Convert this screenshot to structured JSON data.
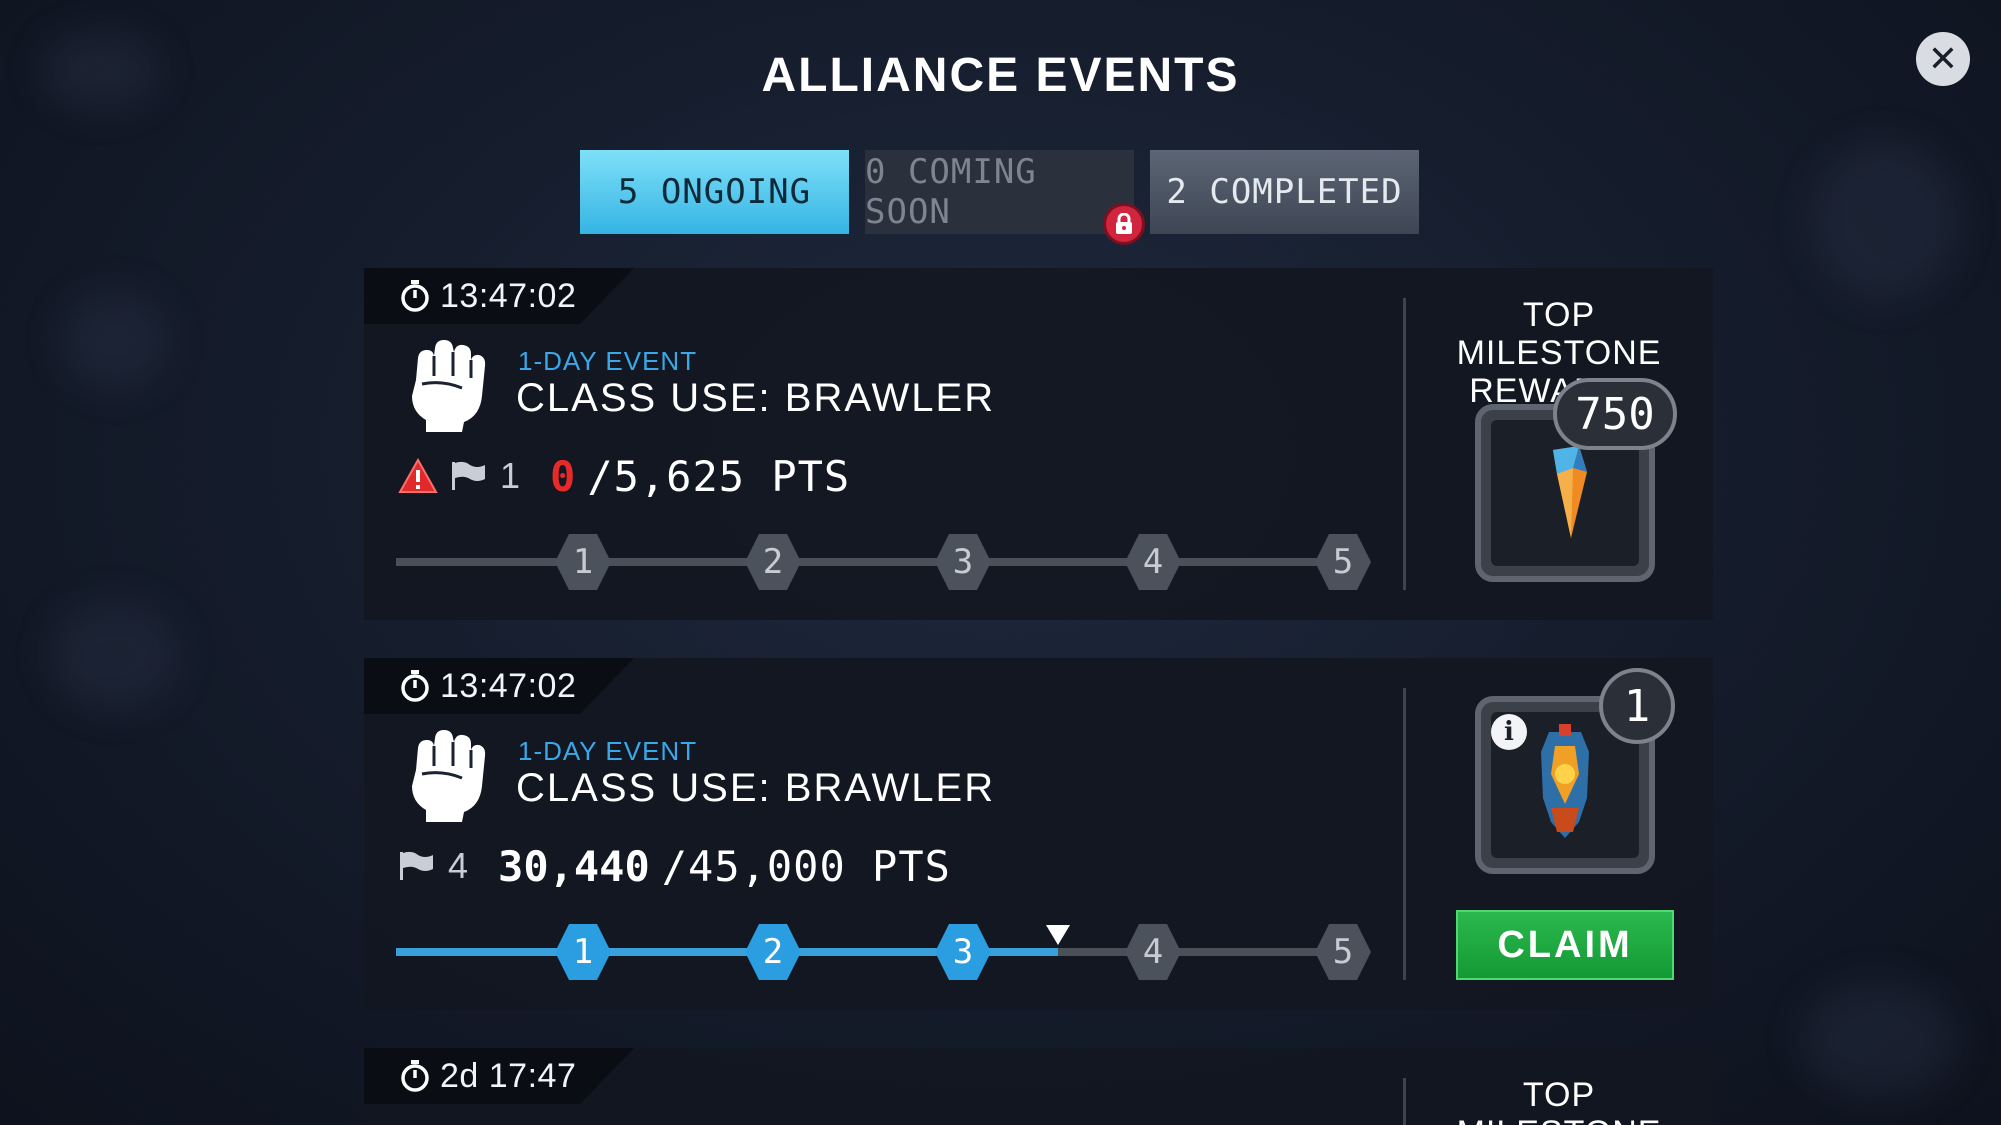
{
  "header": {
    "title": "ALLIANCE EVENTS"
  },
  "tabs": [
    {
      "label": "5 ONGOING",
      "active": true
    },
    {
      "label": "0 COMING SOON",
      "locked": true
    },
    {
      "label": "2 COMPLETED"
    }
  ],
  "events": [
    {
      "timer": "13:47:02",
      "type": "1-DAY EVENT",
      "name": "CLASS USE: BRAWLER",
      "warning": true,
      "flag_count": "1",
      "points_current": "0",
      "points_target": "/5,625 PTS",
      "milestones": [
        "1",
        "2",
        "3",
        "4",
        "5"
      ],
      "progress_fraction": 0,
      "reward_title": "TOP MILESTONE REWARDS",
      "reward_count": "750"
    },
    {
      "timer": "13:47:02",
      "type": "1-DAY EVENT",
      "name": "CLASS USE: BRAWLER",
      "warning": false,
      "flag_count": "4",
      "points_current": "30,440",
      "points_target": "/45,000 PTS",
      "milestones": [
        "1",
        "2",
        "3",
        "4",
        "5"
      ],
      "milestones_completed": 3,
      "reward_count": "1",
      "claim_label": "CLAIM"
    },
    {
      "timer": "2d 17:47",
      "reward_title": "TOP MILESTONE"
    }
  ],
  "colors": {
    "accent": "#35b4e4",
    "progress": "#2a9ee0",
    "warning": "#e62a2a",
    "claim": "#1aa93d"
  },
  "icons": {
    "close": "close-icon",
    "lock": "lock-icon",
    "timer": "stopwatch-icon",
    "class": "fist-icon",
    "warning": "warning-triangle-icon",
    "flag": "flag-icon",
    "info": "info-icon"
  }
}
